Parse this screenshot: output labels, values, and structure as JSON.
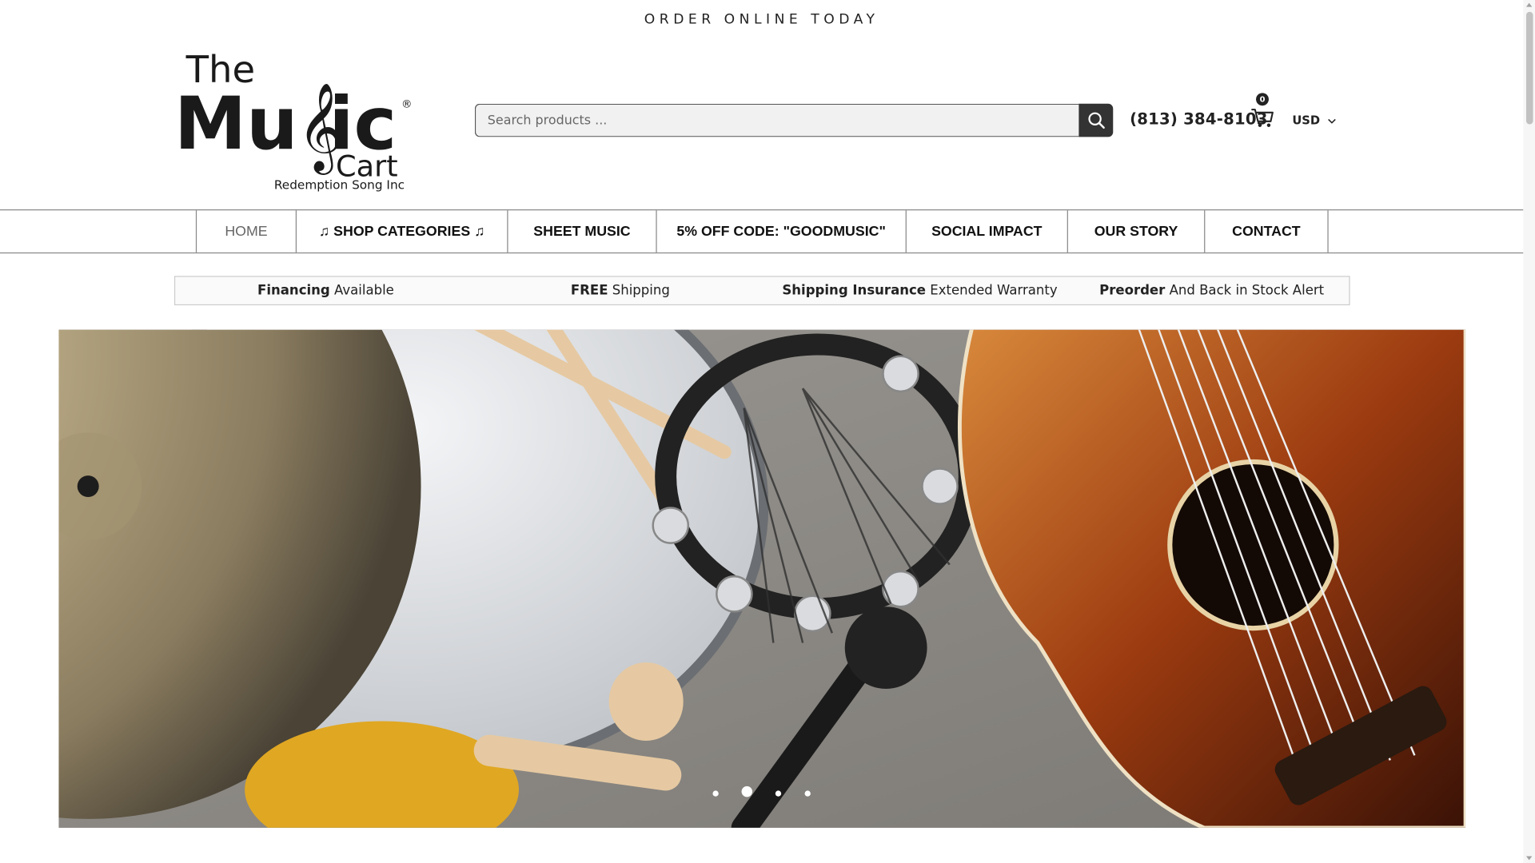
{
  "topbar": {
    "announcement": "ORDER ONLINE TODAY"
  },
  "brand": {
    "line1": "The",
    "line2a": "Mu",
    "line2b": "ic",
    "line3": "Cart",
    "registered": "®",
    "tagline": "Redemption Song Inc"
  },
  "search": {
    "placeholder": "Search products ...",
    "button_icon": "search-icon"
  },
  "header": {
    "phone": "(813) 384-8103",
    "cart_count": "0",
    "currency": "USD"
  },
  "nav": {
    "items": [
      {
        "label": "HOME"
      },
      {
        "label": "♫ SHOP CATEGORIES ♫"
      },
      {
        "label": "SHEET MUSIC"
      },
      {
        "label": "5% OFF CODE: \"GOODMUSIC\""
      },
      {
        "label": "SOCIAL IMPACT"
      },
      {
        "label": "OUR STORY"
      },
      {
        "label": "CONTACT"
      }
    ]
  },
  "benefits": [
    {
      "bold": "Financing",
      "text": " Available"
    },
    {
      "bold": "FREE",
      "text": " Shipping"
    },
    {
      "bold": "Shipping Insurance",
      "text": " Extended Warranty"
    },
    {
      "bold": "Preorder",
      "text": " And Back in Stock Alert"
    }
  ],
  "hero": {
    "slide_count": 4,
    "active_slide": 2
  },
  "colors": {
    "accent": "#333333",
    "nav_border": "#888888"
  }
}
